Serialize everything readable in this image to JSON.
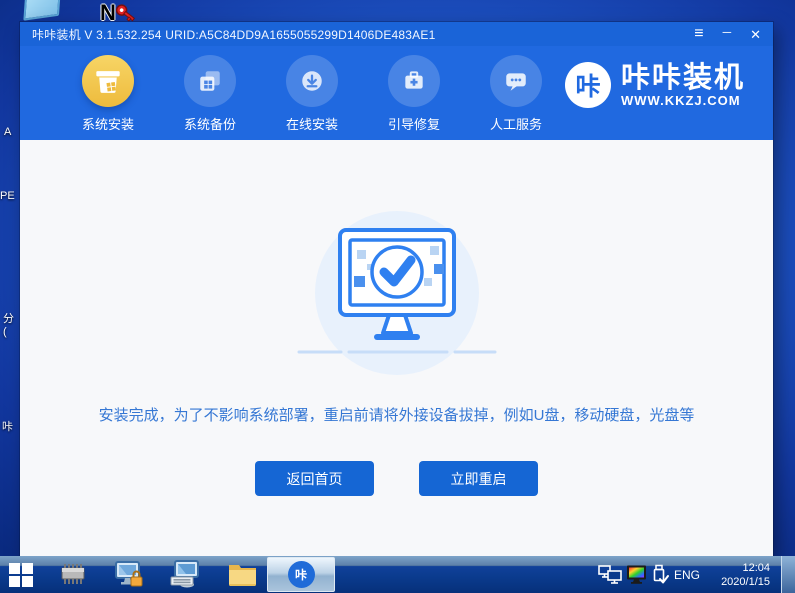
{
  "desktop": {
    "top_icons": {
      "n_letter": "N"
    },
    "edge_labels": {
      "a": "A",
      "pe": "PE",
      "fen": "分",
      "paren": "(",
      "ka": "咔"
    }
  },
  "window": {
    "title": "咔咔装机 V 3.1.532.254 URID:A5C84DD9A1655055299D1406DE483AE1",
    "controls": {
      "menu": "≡",
      "minimize": "─",
      "close": "✕"
    },
    "nav": {
      "items": [
        {
          "label": "系统安装"
        },
        {
          "label": "系统备份"
        },
        {
          "label": "在线安装"
        },
        {
          "label": "引导修复"
        },
        {
          "label": "人工服务"
        }
      ],
      "logo": {
        "badge": "咔",
        "name": "咔咔装机",
        "url": "WWW.KKZJ.COM"
      }
    },
    "content": {
      "message": "安装完成，为了不影响系统部署，重启前请将外接设备拔掉，例如U盘，移动硬盘，光盘等",
      "buttons": {
        "home": "返回首页",
        "restart": "立即重启"
      }
    }
  },
  "taskbar": {
    "app_badge": "咔",
    "language": "ENG",
    "time": "12:04",
    "date": "2020/1/15"
  },
  "colors": {
    "titlebar": "#1a64d8",
    "navbar": "#2069e0",
    "accent_yellow": "#eebb3c",
    "button_blue": "#1566d4",
    "message_blue": "#3577d4",
    "illustration_stroke": "#2f80f0"
  }
}
